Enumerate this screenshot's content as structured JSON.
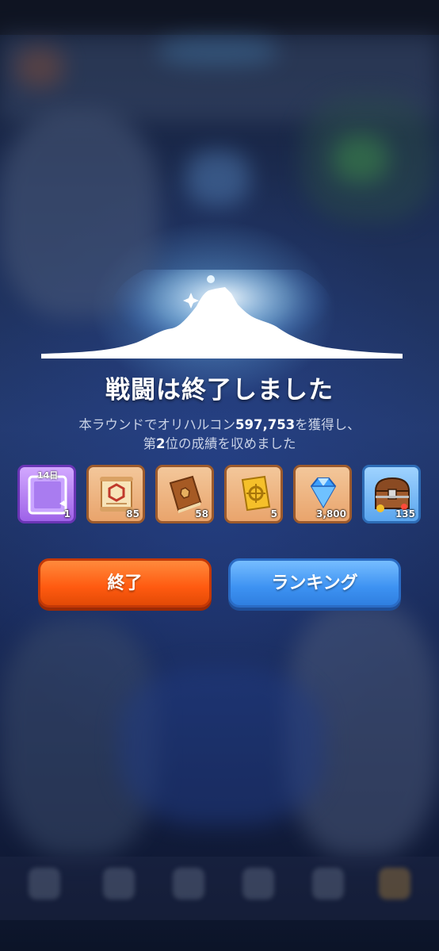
{
  "result": {
    "title": "戦闘は終了しました",
    "message_line1_prefix": "本ラウンドでオリハルコン",
    "orichalcum_amount": "597,753",
    "message_line1_suffix": "を獲得し、",
    "message_line2_prefix": "第",
    "rank": "2",
    "message_line2_suffix": "位の成績を収めました"
  },
  "rewards": [
    {
      "name": "profile-frame",
      "badge": "14日",
      "count": "1",
      "icon": "frame-icon",
      "rarity_color": "#9e62e8"
    },
    {
      "name": "scroll",
      "count": "85",
      "icon": "scroll-icon",
      "rarity_color": "#e9a46c"
    },
    {
      "name": "book",
      "count": "58",
      "icon": "book-icon",
      "rarity_color": "#e9a46c"
    },
    {
      "name": "ticket",
      "count": "5",
      "icon": "ticket-icon",
      "rarity_color": "#e9a46c"
    },
    {
      "name": "gem",
      "count": "3,800",
      "icon": "diamond-icon",
      "rarity_color": "#e9a46c"
    },
    {
      "name": "treasure-chest",
      "count": "135",
      "icon": "chest-icon",
      "rarity_color": "#5aa5ee"
    }
  ],
  "buttons": {
    "end_label": "終了",
    "ranking_label": "ランキング"
  },
  "colors": {
    "end_button": "#ff5a10",
    "ranking_button": "#3d92f2"
  }
}
